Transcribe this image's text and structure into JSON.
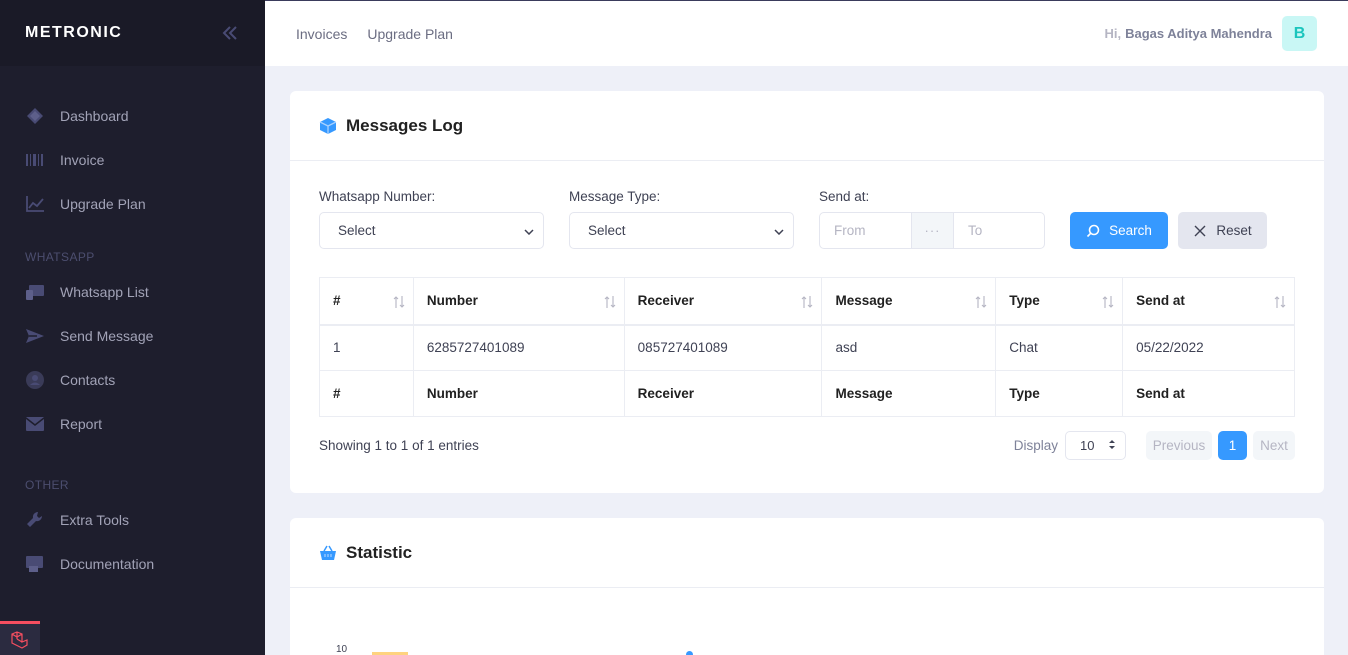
{
  "sidebar": {
    "brand": "METRONIC",
    "items_main": [
      {
        "label": "Dashboard",
        "icon": "layers-icon"
      },
      {
        "label": "Invoice",
        "icon": "barcode-icon"
      },
      {
        "label": "Upgrade Plan",
        "icon": "chart-line-icon"
      }
    ],
    "section_whatsapp": "WHATSAPP",
    "items_whatsapp": [
      {
        "label": "Whatsapp List",
        "icon": "devices-icon"
      },
      {
        "label": "Send Message",
        "icon": "send-icon"
      },
      {
        "label": "Contacts",
        "icon": "user-circle-icon"
      },
      {
        "label": "Report",
        "icon": "mail-icon"
      }
    ],
    "section_other": "OTHER",
    "items_other": [
      {
        "label": "Extra Tools",
        "icon": "wrench-icon"
      },
      {
        "label": "Documentation",
        "icon": "book-icon"
      }
    ]
  },
  "header": {
    "nav": [
      "Invoices",
      "Upgrade Plan"
    ],
    "greeting": "Hi,",
    "user_name": "Bagas Aditya Mahendra",
    "avatar_letter": "B"
  },
  "messages_log": {
    "title": "Messages Log",
    "filters": {
      "whatsapp_label": "Whatsapp Number:",
      "whatsapp_value": "Select",
      "type_label": "Message Type:",
      "type_value": "Select",
      "send_at_label": "Send at:",
      "from_placeholder": "From",
      "sep": "···",
      "to_placeholder": "To",
      "search_label": "Search",
      "reset_label": "Reset"
    },
    "table": {
      "columns": [
        "#",
        "Number",
        "Receiver",
        "Message",
        "Type",
        "Send at"
      ],
      "rows": [
        [
          "1",
          "6285727401089",
          "085727401089",
          "asd",
          "Chat",
          "05/22/2022"
        ]
      ]
    },
    "showing": "Showing 1 to 1 of 1 entries",
    "display_label": "Display",
    "display_value": "10",
    "prev_label": "Previous",
    "current_page": "1",
    "next_label": "Next"
  },
  "statistic": {
    "title": "Statistic",
    "first_tick": "10"
  },
  "colors": {
    "primary": "#3699ff",
    "sidebar_bg": "#1e1e2d",
    "sidebar_brand_bg": "#1a1a27",
    "avatar_bg": "#c9f7f5",
    "avatar_fg": "#1bc5bd",
    "laravel_red": "#f64e60"
  }
}
